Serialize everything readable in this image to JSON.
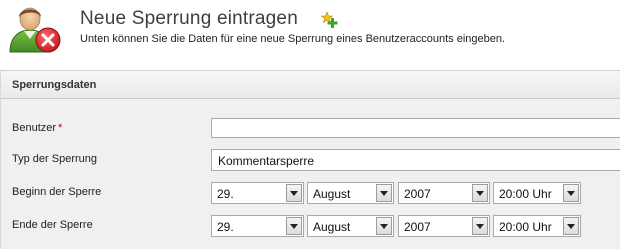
{
  "header": {
    "title": "Neue Sperrung eintragen",
    "subtitle": "Unten können Sie die Daten für eine neue Sperrung eines Benutzeraccounts eingeben."
  },
  "section": {
    "title": "Sperrungsdaten"
  },
  "form": {
    "benutzer": {
      "label": "Benutzer",
      "required_mark": "*",
      "value": ""
    },
    "typ": {
      "label": "Typ der Sperrung",
      "value": "Kommentarsperre"
    },
    "beginn": {
      "label": "Beginn der Sperre",
      "day": "29.",
      "month": "August",
      "year": "2007",
      "time": "20:00 Uhr"
    },
    "ende": {
      "label": "Ende der Sperre",
      "day": "29.",
      "month": "August",
      "year": "2007",
      "time": "20:00 Uhr"
    }
  },
  "icons": {
    "header_icon": "user-remove-icon",
    "add_icon": "add-icon"
  },
  "colors": {
    "delete_red": "#d8262b",
    "add_green": "#3aa329",
    "add_yellow": "#f0c419",
    "required": "#cc0000"
  }
}
